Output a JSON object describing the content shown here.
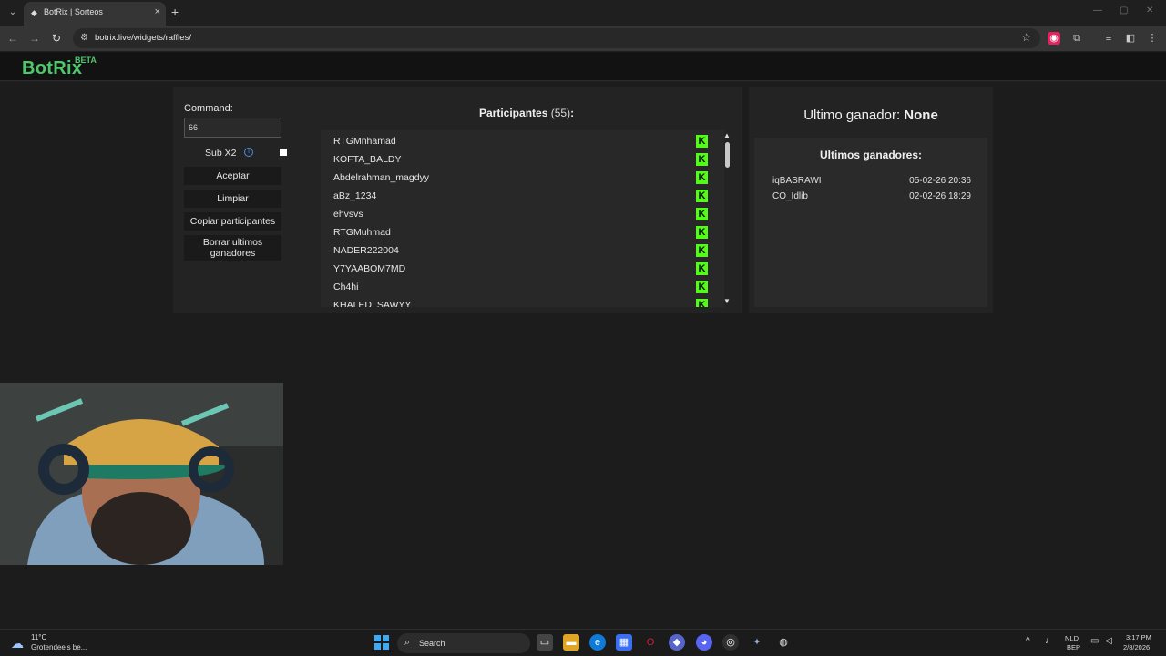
{
  "browser": {
    "tab_title": "BotRix | Sorteos",
    "url": "botrix.live/widgets/raffles/"
  },
  "header": {
    "logo": "BotRix",
    "beta": "BETA"
  },
  "controls": {
    "command_label": "Command:",
    "command_value": "66",
    "sub_label": "Sub X2",
    "sub_checked": false,
    "accept": "Aceptar",
    "clear": "Limpiar",
    "copy": "Copiar participantes",
    "delete_line1": "Borrar ultimos",
    "delete_line2": "ganadores"
  },
  "participants": {
    "title": "Participantes",
    "count": "(55)",
    "colon": ":",
    "items": [
      "RTGMnhamad",
      "KOFTA_BALDY",
      "Abdelrahman_magdyy",
      "aBz_1234",
      "ehvsvs",
      "RTGMuhmad",
      "NADER222004",
      "Y7YAABOM7MD",
      "Ch4hi",
      "KHALED_SAWYY"
    ]
  },
  "winner": {
    "label": "Ultimo ganador:",
    "value": "None",
    "list_title": "Ultimos ganadores:",
    "list": [
      {
        "name": "iqBASRAWI",
        "date": "05-02-26 20:36"
      },
      {
        "name": "CO_Idlib",
        "date": "02-02-26 18:29"
      }
    ]
  },
  "taskbar": {
    "temp": "11°C",
    "weather": "Grotendeels be...",
    "search": "Search",
    "lang1": "NLD",
    "lang2": "BEP",
    "time": "3:17 PM",
    "date": "2/8/2026"
  },
  "colors": {
    "brand": "#4ec86a",
    "kick": "#53fc18"
  }
}
